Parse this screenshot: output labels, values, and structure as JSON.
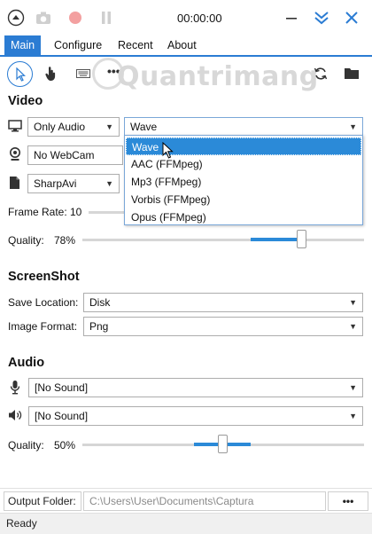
{
  "window": {
    "timer": "00:00:00"
  },
  "menu": {
    "items": [
      "Main",
      "Configure",
      "Recent",
      "About"
    ]
  },
  "watermark": "Quantrimang",
  "video": {
    "title": "Video",
    "audio_source": "Only Audio",
    "format": "Wave",
    "format_options": [
      "Wave",
      "AAC (FFMpeg)",
      "Mp3 (FFMpeg)",
      "Vorbis (FFMpeg)",
      "Opus (FFMpeg)"
    ],
    "webcam": "No WebCam",
    "encoder": "SharpAvi",
    "frame_rate_label": "Frame Rate:",
    "frame_rate_value": "10",
    "quality_label": "Quality:",
    "quality_value": "78%",
    "quality_fraction": 0.78
  },
  "screenshot": {
    "title": "ScreenShot",
    "save_location_label": "Save Location:",
    "save_location": "Disk",
    "image_format_label": "Image Format:",
    "image_format": "Png"
  },
  "audio": {
    "title": "Audio",
    "microphone": "[No Sound]",
    "speaker": "[No Sound]",
    "quality_label": "Quality:",
    "quality_value": "50%",
    "quality_fraction": 0.5
  },
  "output": {
    "label": "Output Folder:",
    "path": "C:\\Users\\User\\Documents\\Captura",
    "browse_label": "•••"
  },
  "status": "Ready",
  "colors": {
    "accent": "#2b7cd3",
    "record_dot": "#e57373"
  }
}
